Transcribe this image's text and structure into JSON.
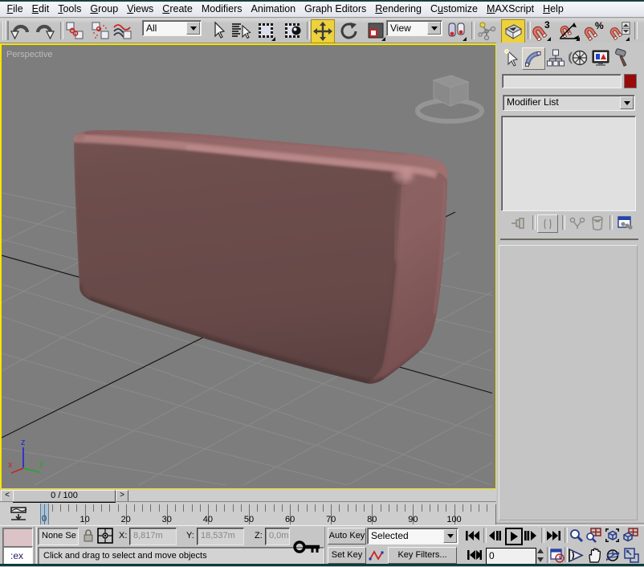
{
  "menu": {
    "items": [
      {
        "label": "File",
        "accel": "F"
      },
      {
        "label": "Edit",
        "accel": "E"
      },
      {
        "label": "Tools",
        "accel": "T"
      },
      {
        "label": "Group",
        "accel": "G"
      },
      {
        "label": "Views",
        "accel": "V"
      },
      {
        "label": "Create",
        "accel": "C"
      },
      {
        "label": "Modifiers",
        "accel": ""
      },
      {
        "label": "Animation",
        "accel": ""
      },
      {
        "label": "Graph Editors",
        "accel": ""
      },
      {
        "label": "Rendering",
        "accel": "R"
      },
      {
        "label": "Customize",
        "accel": "u"
      },
      {
        "label": "MAXScript",
        "accel": "M"
      },
      {
        "label": "Help",
        "accel": "H"
      }
    ]
  },
  "toolbar": {
    "selection_filter_value": "All",
    "coordinate_system_value": "View",
    "snap_superscript": "3",
    "percent_sign": "%",
    "icons": [
      "undo-icon",
      "redo-icon",
      "select-and-link-icon",
      "unlink-selection-icon",
      "bind-to-spacewarp-icon",
      "select-object-icon",
      "select-by-name-icon",
      "rectangular-selection-icon",
      "window-crossing-icon",
      "select-and-move-icon",
      "select-and-rotate-icon",
      "select-and-scale-icon",
      "use-pivot-center-icon",
      "select-and-manipulate-icon",
      "keyboard-override-icon",
      "snap-3d-icon",
      "angle-snap-icon",
      "percent-snap-icon",
      "spinner-snap-icon"
    ],
    "active_tools": [
      "select-and-move",
      "keyboard-override"
    ]
  },
  "viewport": {
    "label": "Perspective",
    "axis_tripod": {
      "x": "x",
      "y": "y",
      "z": "z"
    },
    "background": "#7d7d7d",
    "border_color": "#f6e500",
    "object_color": "#b28080"
  },
  "command_panel": {
    "tabs": [
      "create-tab",
      "modify-tab",
      "hierarchy-tab",
      "motion-tab",
      "display-tab",
      "utilities-tab"
    ],
    "active_tab": "modify-tab",
    "name_field_value": "",
    "object_color": "#990b0b",
    "modifier_list_label": "Modifier List",
    "stack_buttons": [
      "pin-stack-icon",
      "show-end-result-icon",
      "make-unique-icon",
      "remove-modifier-icon",
      "configure-modifier-sets-icon"
    ]
  },
  "time_slider": {
    "value": "0 / 100",
    "prev_label": "<",
    "next_label": ">"
  },
  "track_bar": {
    "tick_labels": [
      "0",
      "10",
      "20",
      "30",
      "40",
      "50",
      "60",
      "70",
      "80",
      "90",
      "100"
    ],
    "current_frame": "0"
  },
  "status_bar": {
    "macro_recorder_color": "#dcc3c7",
    "listener_text": ":ex",
    "selection_status": "None Se",
    "x_label": "X:",
    "x_value": "8,817m",
    "y_label": "Y:",
    "y_value": "18,537m",
    "z_label": "Z:",
    "z_value": "0,0m",
    "prompt": "Click and drag to select and move objects"
  },
  "animation_controls": {
    "auto_key_label": "Auto Key",
    "set_key_label": "Set Key",
    "key_filter_value": "Selected",
    "key_filters_label": "Key Filters...",
    "frame_field_value": "0",
    "icons": [
      "set-keys-key-icon",
      "default-tangent-icon",
      "frame-spinner-icon"
    ]
  },
  "playback_controls": {
    "icons": [
      "go-to-start-icon",
      "previous-frame-icon",
      "play-icon",
      "next-frame-icon",
      "go-to-end-icon",
      "key-mode-toggle-icon",
      "time-configuration-icon"
    ]
  },
  "viewport_navigation": {
    "icons": [
      "zoom-icon",
      "zoom-all-icon",
      "zoom-extents-icon",
      "zoom-extents-all-icon",
      "field-of-view-icon",
      "pan-hand-icon",
      "arc-rotate-icon",
      "min-max-toggle-icon"
    ]
  },
  "status_icons": [
    "selection-lock-icon",
    "absolute-mode-toggle-icon",
    "open-mini-curve-editor-icon"
  ],
  "colors": {
    "panel_face": "#c6c6c6",
    "viewport_background": "#7d7d7d",
    "viewport_active_border": "#f6e500",
    "active_tool_highlight": "#edd13d",
    "object_front_face": "#694b4a",
    "object_top_face": "#966969",
    "object_side_face": "#885f5f",
    "object_chamfer_highlight": "#b08080",
    "frame_marker_blue": "#a8c4da",
    "window_edge_teal": "#173f3f",
    "macro_recorder_pink": "#dcc3c7",
    "object_color_swatch": "#990b0b"
  }
}
